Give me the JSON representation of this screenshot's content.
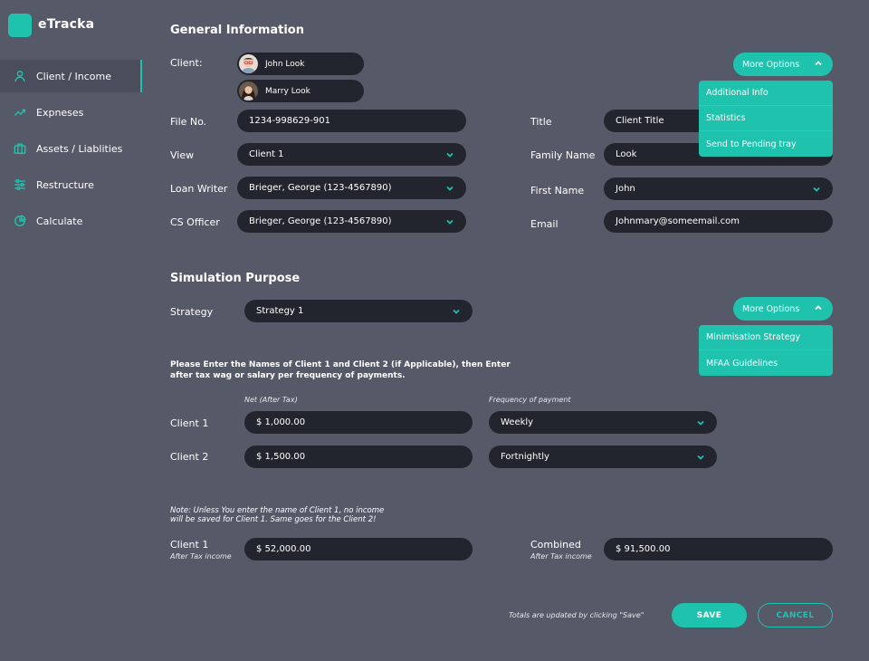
{
  "app": {
    "name": "eTracka"
  },
  "sidebar": {
    "items": [
      {
        "label": "Client / Income",
        "icon": "user-icon",
        "active": true
      },
      {
        "label": "Expneses",
        "icon": "trend-up-icon"
      },
      {
        "label": "Assets / Liablities",
        "icon": "briefcase-icon"
      },
      {
        "label": "Restructure",
        "icon": "sliders-icon"
      },
      {
        "label": "Calculate",
        "icon": "pie-chart-icon"
      }
    ]
  },
  "general": {
    "title": "General Information",
    "client_label": "Client:",
    "clients": [
      "John Look",
      "Marry Look"
    ],
    "file_no_label": "File No.",
    "file_no": "1234-998629-901",
    "view_label": "View",
    "view": "Client 1",
    "loan_writer_label": "Loan Writer",
    "loan_writer": "Brieger, George (123-4567890)",
    "cs_officer_label": "CS Officer",
    "cs_officer": "Brieger, George (123-4567890)",
    "title_label": "Title",
    "title_value": "Client Title",
    "family_name_label": "Family Name",
    "family_name": "Look",
    "first_name_label": "First Name",
    "first_name": "John",
    "email_label": "Email",
    "email": "Johnmary@someemail.com",
    "more_options": "More Options",
    "menu": [
      "Additional Info",
      "Statistics",
      "Send to Pending tray"
    ]
  },
  "simulation": {
    "title": "Simulation Purpose",
    "strategy_label": "Strategy",
    "strategy": "Strategy 1",
    "more_options": "More Options",
    "menu": [
      "Minimisation Strategy",
      "MFAA Guidelines"
    ],
    "instruction_line1": "Please Enter the Names of Client 1 and Client 2 (if Applicable), then Enter",
    "instruction_line2": "after tax wag or salary per frequency of payments.",
    "col_net": "Net (After Tax)",
    "col_freq": "Frequency of payment",
    "rows": [
      {
        "label": "Client 1",
        "net": "$ 1,000.00",
        "freq": "Weekly"
      },
      {
        "label": "Client 2",
        "net": "$ 1,500.00",
        "freq": "Fortnightly"
      }
    ],
    "note_line1": "Note: Unless You enter the name of Client 1, no income",
    "note_line2": "will be saved for Client 1. Same goes for the Client 2!",
    "client1_total_label": "Client 1",
    "client1_total_sub": "After Tax income",
    "client1_total": "$ 52,000.00",
    "combined_label": "Combined",
    "combined_sub": "After Tax income",
    "combined_total": "$ 91,500.00",
    "totals_note": "Totals are updated by clicking \"Save\""
  },
  "actions": {
    "save": "SAVE",
    "cancel": "CANCEL"
  },
  "colors": {
    "accent": "#1ec2ad",
    "background": "#565968",
    "field": "#23252e"
  }
}
